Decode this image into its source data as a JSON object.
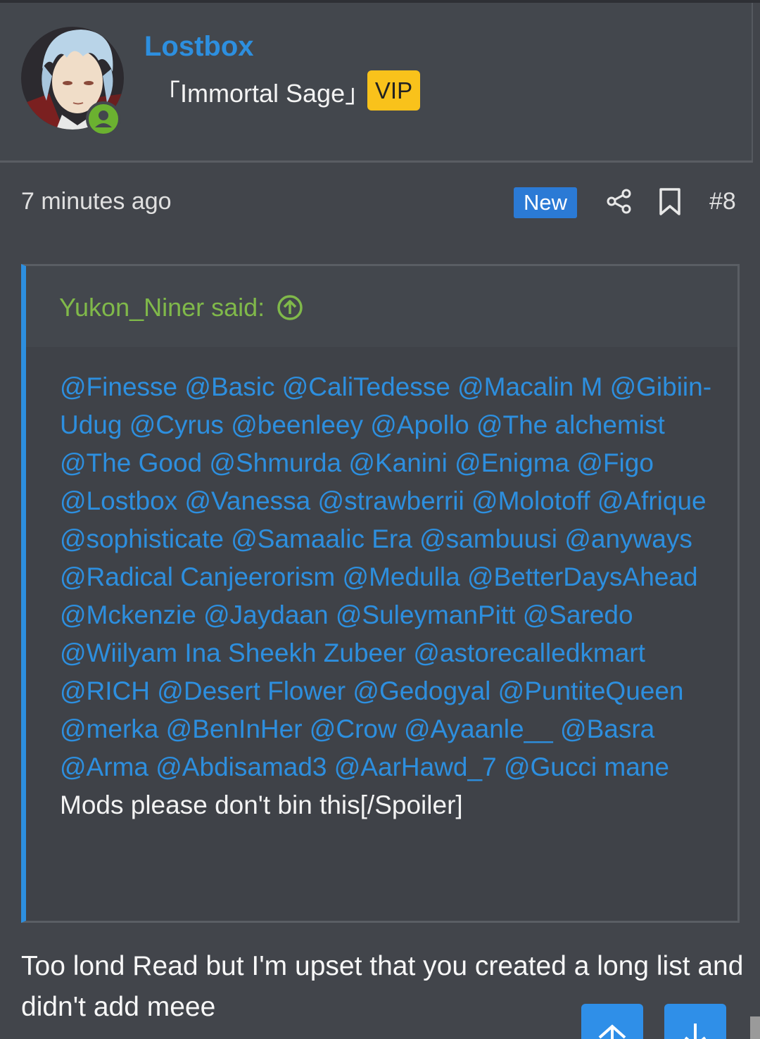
{
  "user": {
    "name": "Lostbox",
    "title": "「Immortal Sage」",
    "badge": "VIP"
  },
  "post": {
    "time": "7 minutes ago",
    "new_label": "New",
    "number": "#8"
  },
  "quote": {
    "author": "Yukon_Niner said:",
    "mentions": [
      "@Finesse",
      "@Basic",
      "@CaliTedesse",
      "@Macalin M",
      "@Gibiin-Udug",
      "@Cyrus",
      "@beenleey",
      "@Apollo",
      "@The alchemist",
      "@The Good",
      "@Shmurda",
      "@Kanini",
      "@Enigma",
      "@Figo",
      "@Lostbox",
      "@Vanessa",
      "@strawberrii",
      "@Molotoff",
      "@Afrique",
      "@sophisticate",
      "@Samaalic Era",
      "@sambuusi",
      "@anyways",
      "@Radical Canjeerorism",
      "@Medulla",
      "@BetterDaysAhead",
      "@Mckenzie",
      "@Jaydaan",
      "@SuleymanPitt",
      "@Saredo",
      "@Wiilyam Ina Sheekh Zubeer",
      "@astorecalledkmart",
      "@RICH",
      "@Desert Flower",
      "@Gedogyal",
      "@PuntiteQueen",
      "@merka",
      "@BenInHer",
      "@Crow",
      "@Ayaanle__",
      "@Basra",
      "@Arma",
      "@Abdisamad3",
      "@AarHawd_7",
      "@Gucci mane"
    ],
    "closing_text": "Mods please don't bin this[/Spoiler]"
  },
  "reply": {
    "text": "Too lond Read but I'm upset that you created a long list and didn't add meee"
  },
  "icons": {
    "share": "share-icon",
    "bookmark": "bookmark-icon",
    "quote_jump": "arrow-up-circle-icon",
    "scroll_up": "arrow-up-icon",
    "scroll_down": "arrow-down-icon"
  },
  "colors": {
    "background": "#42454b",
    "accent": "#2d8fdf",
    "quote_author": "#80b94a",
    "vip": "#f9c21b",
    "new_badge": "#2b7ad5",
    "online": "#6bb130"
  }
}
